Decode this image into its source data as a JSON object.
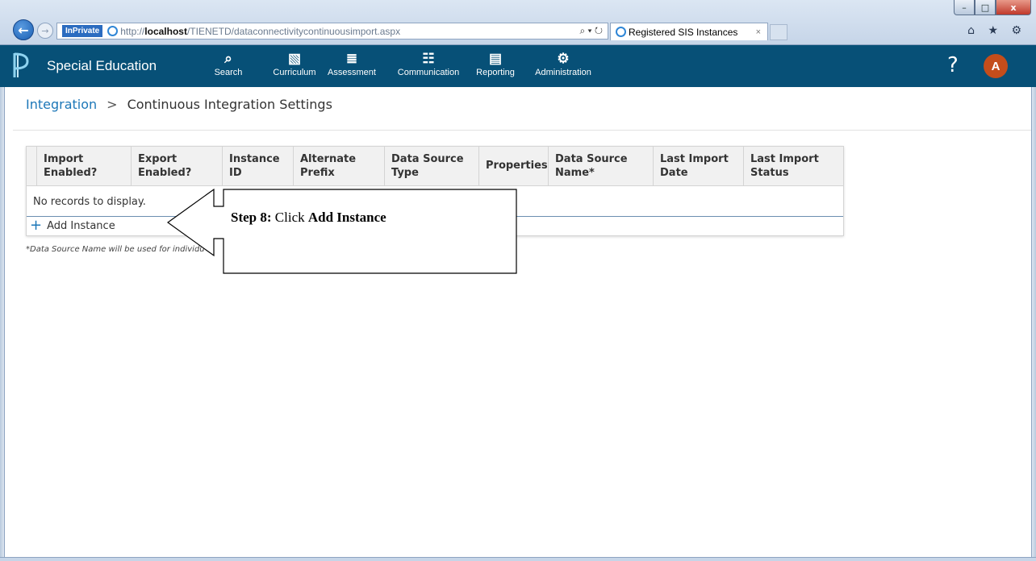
{
  "browser": {
    "inprivate_label": "InPrivate",
    "url_prefix": "http://",
    "url_host": "localhost",
    "url_path": "/TIENETD/dataconnectivitycontinuousimport.aspx",
    "address_tools": "⌕ ▾ ↻",
    "tab_title": "Registered SIS Instances",
    "tab_close": "×",
    "toolbar_icons": "⌂ ★ ⚙",
    "window_controls": {
      "minimize": "–",
      "maximize": "□",
      "close": "x"
    }
  },
  "app": {
    "title": "Special Education",
    "nav": [
      {
        "label": "Search",
        "icon": "⌕"
      },
      {
        "label": "Curriculum",
        "icon": "▧"
      },
      {
        "label": "Assessment",
        "icon": "≣"
      },
      {
        "label": "Communication",
        "icon": "☷"
      },
      {
        "label": "Reporting",
        "icon": "▤"
      },
      {
        "label": "Administration",
        "icon": "⚙"
      }
    ],
    "help": "?",
    "avatar_initial": "A",
    "brand_color": "#075077",
    "avatar_color": "#c44d1b"
  },
  "breadcrumb": {
    "parent": "Integration",
    "separator": ">",
    "current": "Continuous Integration Settings"
  },
  "grid": {
    "columns": [
      {
        "line1": "Import",
        "line2": "Enabled?"
      },
      {
        "line1": "Export",
        "line2": "Enabled?"
      },
      {
        "line1": "Instance",
        "line2": "ID"
      },
      {
        "line1": "Alternate",
        "line2": "Prefix"
      },
      {
        "line1": "Data Source",
        "line2": "Type"
      },
      {
        "line1": "Properties",
        "line2": ""
      },
      {
        "line1": "Data Source",
        "line2": "Name*"
      },
      {
        "line1": "Last Import",
        "line2": "Date"
      },
      {
        "line1": "Last Import",
        "line2": "Status"
      }
    ],
    "empty_message": "No records to display.",
    "add_label": "Add Instance",
    "add_symbol": "+"
  },
  "footnote": "*Data Source Name will be used for individu",
  "callout": {
    "step_label": "Step 8:",
    "verb": "Click",
    "target": "Add Instance"
  }
}
